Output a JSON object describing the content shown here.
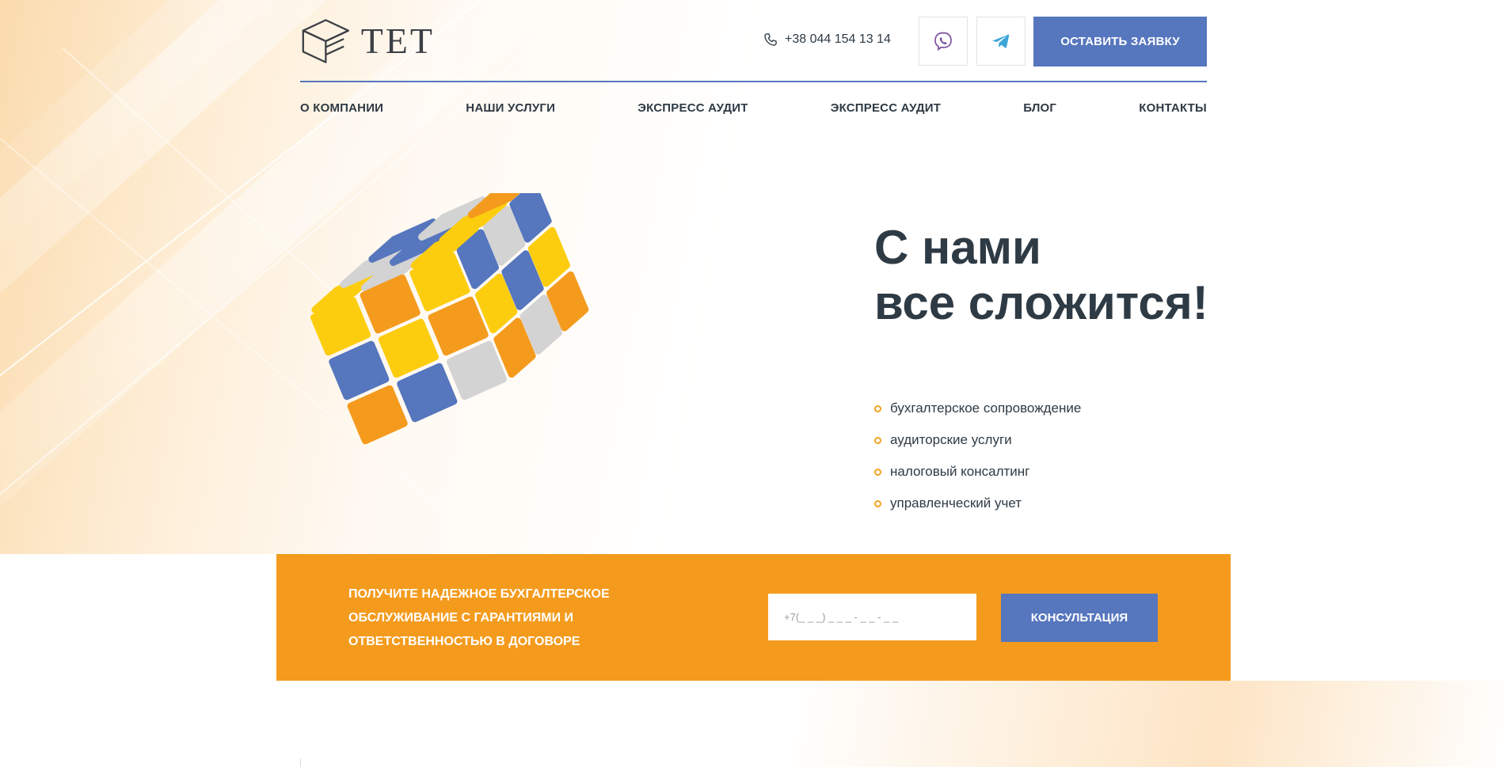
{
  "header": {
    "logo_text": "ТЕТ",
    "phone": "+38 044 154 13 14",
    "phone_icon": "phone-icon",
    "viber_icon": "viber-icon",
    "telegram_icon": "telegram-icon",
    "cta_label": "ОСТАВИТЬ ЗАЯВКУ"
  },
  "nav": {
    "items": [
      {
        "label": "О КОМПАНИИ"
      },
      {
        "label": "НАШИ УСЛУГИ"
      },
      {
        "label": "ЭКСПРЕСС АУДИТ"
      },
      {
        "label": "ЭКСПРЕСС АУДИТ"
      },
      {
        "label": "БЛОГ"
      },
      {
        "label": "КОНТАКТЫ"
      }
    ]
  },
  "hero": {
    "title_line1": "С нами",
    "title_line2": "все сложится!",
    "services": [
      {
        "label": "бухгалтерское сопровождение"
      },
      {
        "label": "аудиторские услуги"
      },
      {
        "label": "налоговый консалтинг"
      },
      {
        "label": "управленческий учет"
      }
    ],
    "image": "rubiks-cube-illustration"
  },
  "band": {
    "text_line1": "ПОЛУЧИТЕ НАДЕЖНОЕ БУХГАЛТЕРСКОЕ",
    "text_line2": "ОБСЛУЖИВАНИЕ С ГАРАНТИЯМИ И",
    "text_line3": "ОТВЕТСТВЕННОСТЬЮ В ДОГОВОРЕ",
    "phone_placeholder": "+7(_ _ _) _ _ _ - _ _ - _ _",
    "button_label": "КОНСУЛЬТАЦИЯ"
  },
  "colors": {
    "accent_blue": "#5676be",
    "accent_orange": "#f49b1d",
    "cube_yellow": "#fccd0e",
    "cube_gray": "#d3d3d3",
    "text_dark": "#2e3a44"
  }
}
